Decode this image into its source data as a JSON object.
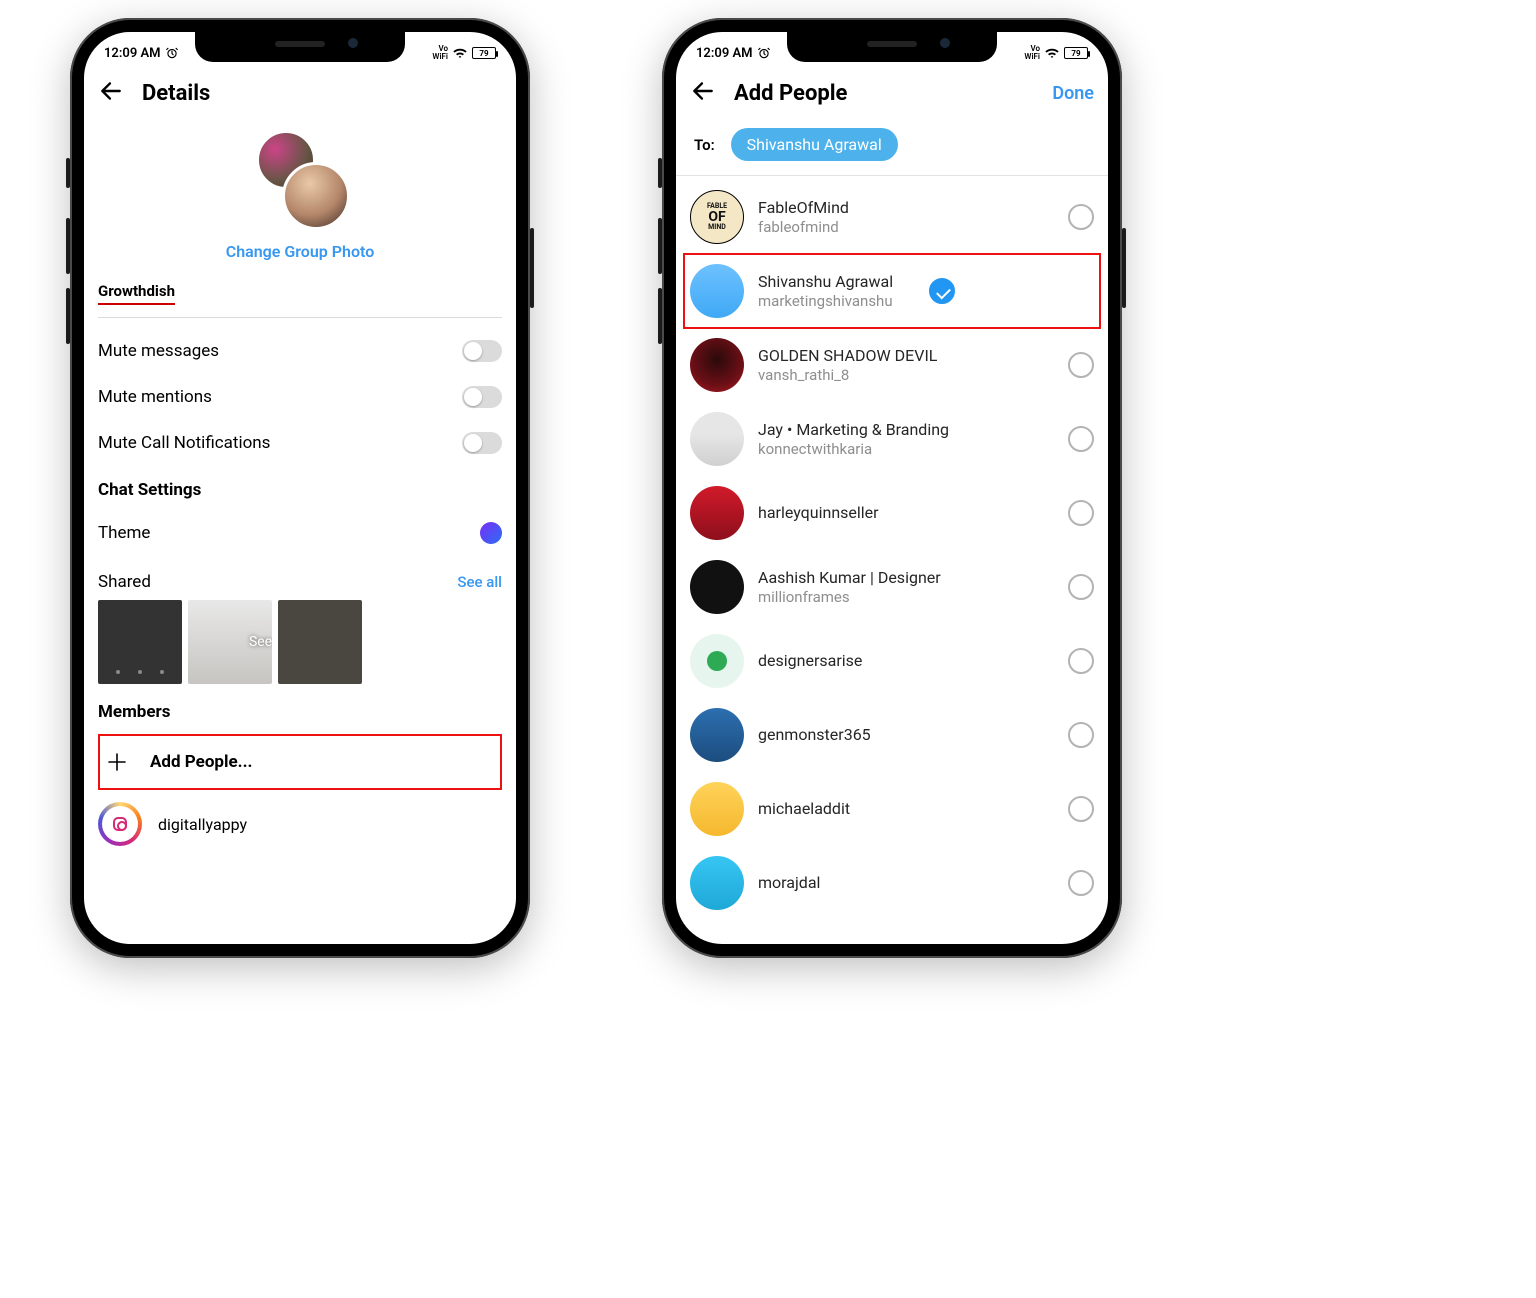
{
  "status": {
    "time": "12:09 AM",
    "wifi_small1": "Vo",
    "wifi_small2": "WiFi",
    "battery": "79"
  },
  "left": {
    "title": "Details",
    "change_photo": "Change Group Photo",
    "group_name": "Growthdish",
    "mute_messages": "Mute messages",
    "mute_mentions": "Mute mentions",
    "mute_calls": "Mute Call Notifications",
    "chat_settings": "Chat Settings",
    "theme": "Theme",
    "shared": "Shared",
    "see_all": "See all",
    "see_all_overlay": "See all",
    "members": "Members",
    "add_people": "Add People...",
    "member1": "digitallyappy"
  },
  "right": {
    "title": "Add People",
    "done": "Done",
    "to_label": "To:",
    "chip": "Shivanshu Agrawal",
    "people": [
      {
        "name": "FableOfMind",
        "user": "fableofmind",
        "checked": false
      },
      {
        "name": "Shivanshu Agrawal",
        "user": "marketingshivanshu",
        "checked": true
      },
      {
        "name": "GOLDEN SHADOW DEVIL",
        "user": "vansh_rathi_8",
        "checked": false
      },
      {
        "name": "Jay • Marketing & Branding",
        "user": "konnectwithkaria",
        "checked": false
      },
      {
        "name": "harleyquinnseller",
        "user": "",
        "checked": false
      },
      {
        "name": "Aashish Kumar | Designer",
        "user": "millionframes",
        "checked": false
      },
      {
        "name": "designersarise",
        "user": "",
        "checked": false
      },
      {
        "name": "genmonster365",
        "user": "",
        "checked": false
      },
      {
        "name": "michaeladdit",
        "user": "",
        "checked": false
      },
      {
        "name": "morajdal",
        "user": "",
        "checked": false
      }
    ]
  }
}
